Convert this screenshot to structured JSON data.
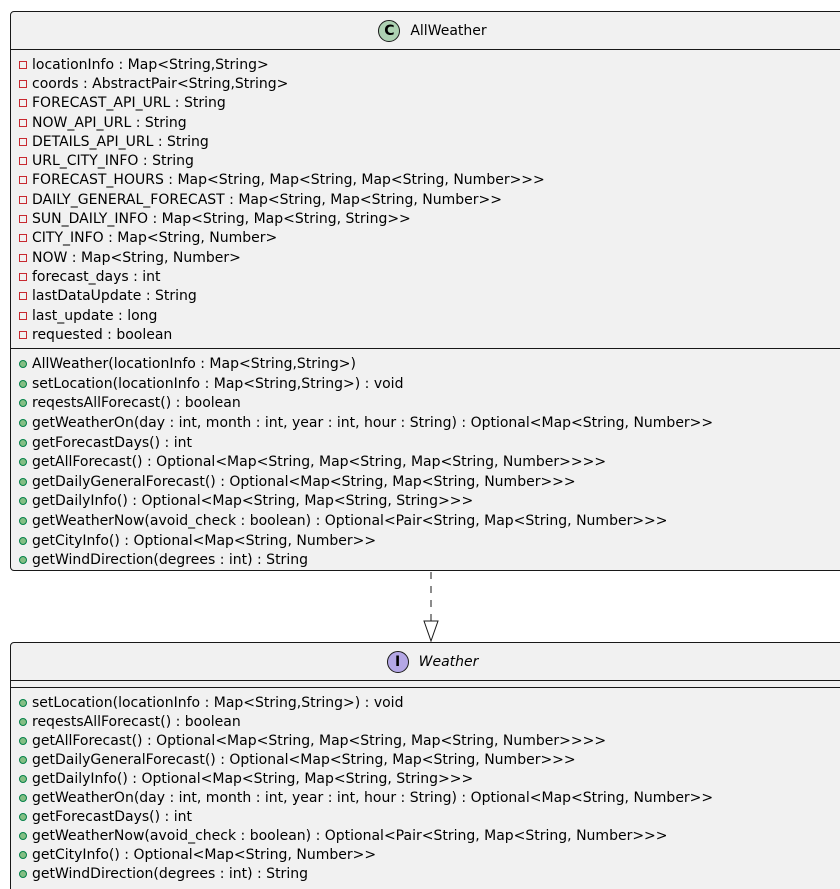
{
  "class_box": {
    "stereotype_letter": "C",
    "title": "AllWeather",
    "attributes": [
      "locationInfo : Map<String,String>",
      "coords : AbstractPair<String,String>",
      "FORECAST_API_URL : String",
      "NOW_API_URL : String",
      "DETAILS_API_URL : String",
      "URL_CITY_INFO : String",
      "FORECAST_HOURS : Map<String, Map<String, Map<String, Number>>>",
      "DAILY_GENERAL_FORECAST : Map<String, Map<String, Number>>",
      "SUN_DAILY_INFO : Map<String, Map<String, String>>",
      "CITY_INFO : Map<String, Number>",
      "NOW : Map<String, Number>",
      "forecast_days : int",
      "lastDataUpdate : String",
      "last_update : long",
      "requested : boolean"
    ],
    "methods": [
      "AllWeather(locationInfo : Map<String,String>)",
      "setLocation(locationInfo : Map<String,String>) : void",
      "reqestsAllForecast() : boolean",
      "getWeatherOn(day : int, month : int, year : int, hour : String) : Optional<Map<String, Number>>",
      "getForecastDays() : int",
      "getAllForecast() : Optional<Map<String, Map<String, Map<String, Number>>>>",
      "getDailyGeneralForecast() : Optional<Map<String, Map<String, Number>>>",
      "getDailyInfo() : Optional<Map<String, Map<String, String>>>",
      "getWeatherNow(avoid_check : boolean) : Optional<Pair<String, Map<String, Number>>>",
      "getCityInfo() : Optional<Map<String, Number>>",
      "getWindDirection(degrees : int) : String"
    ]
  },
  "interface_box": {
    "stereotype_letter": "I",
    "title": "Weather",
    "methods": [
      "setLocation(locationInfo : Map<String,String>) : void",
      "reqestsAllForecast() : boolean",
      "getAllForecast() : Optional<Map<String, Map<String, Map<String, Number>>>>",
      "getDailyGeneralForecast() : Optional<Map<String, Map<String, Number>>>",
      "getDailyInfo() : Optional<Map<String, Map<String, String>>>",
      "getWeatherOn(day : int, month : int, year : int, hour : String) : Optional<Map<String, Number>>",
      "getForecastDays() : int",
      "getWeatherNow(avoid_check : boolean) : Optional<Pair<String, Map<String, Number>>>",
      "getCityInfo() : Optional<Map<String, Number>>",
      "getWindDirection(degrees : int) : String"
    ]
  },
  "colors": {
    "box_fill": "#f1f1f1",
    "border": "#181818",
    "class_circle": "#add1b2",
    "interface_circle": "#b4a7e5",
    "private_marker": "#c82930",
    "public_marker": "#84be84"
  }
}
